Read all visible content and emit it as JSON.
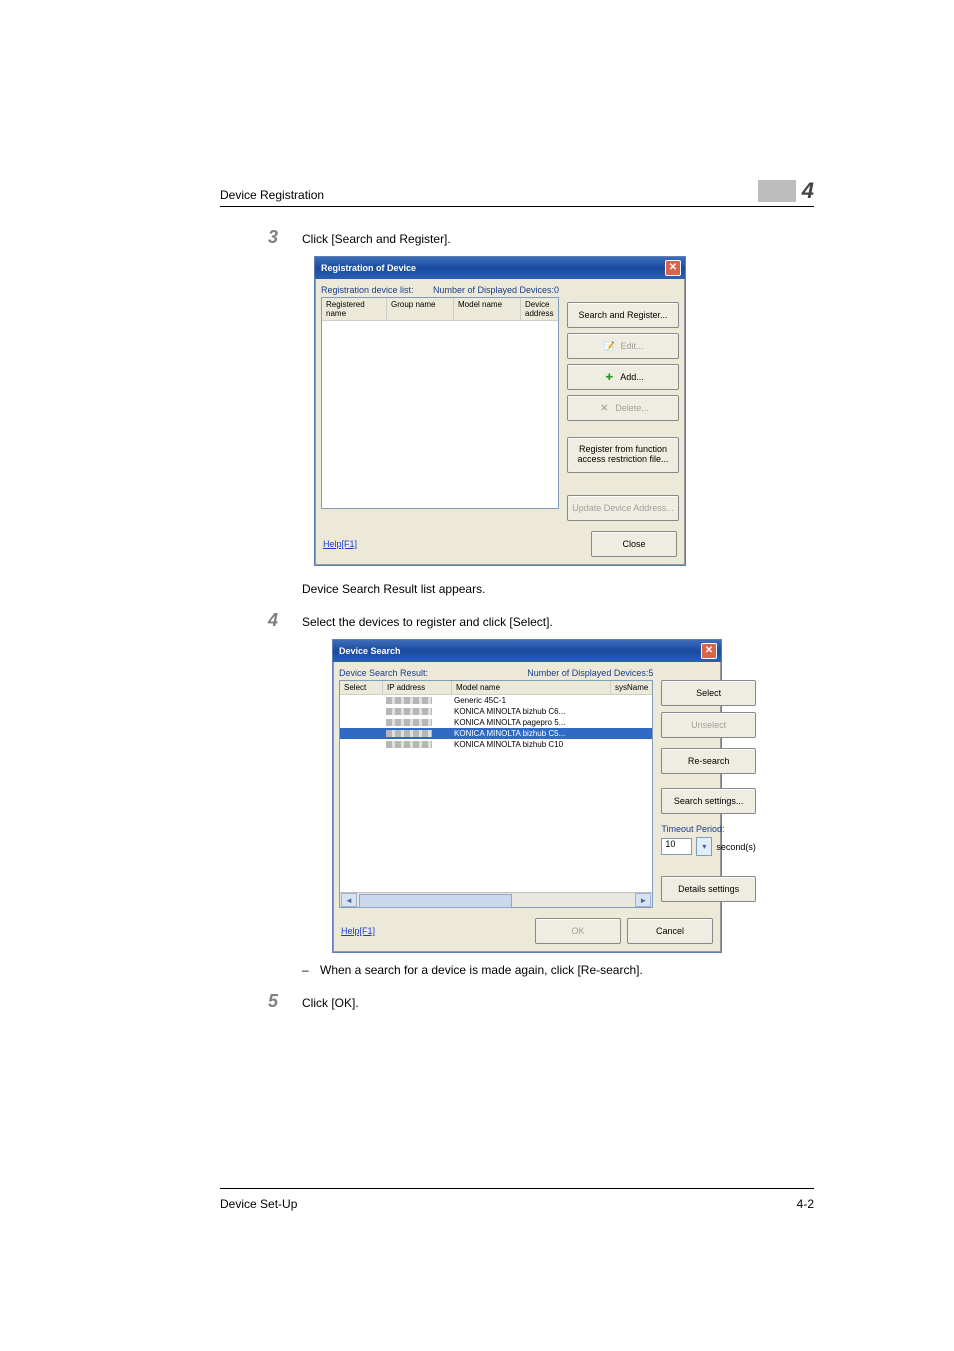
{
  "header": {
    "title": "Device Registration",
    "chapter": "4"
  },
  "steps": {
    "s3": {
      "num": "3",
      "text": "Click [Search and Register]."
    },
    "between_3_4": "Device Search Result list appears.",
    "s4": {
      "num": "4",
      "text": "Select the devices to register and click [Select]."
    },
    "bullet": "When a search for a device is made again, click [Re-search].",
    "s5": {
      "num": "5",
      "text": "Click [OK]."
    }
  },
  "dialog1": {
    "title": "Registration of Device",
    "list_label": "Registration device list:",
    "count_label": "Number of Displayed Devices:0",
    "columns": {
      "registered": "Registered name",
      "group": "Group name",
      "model": "Model name",
      "device": "Device address"
    },
    "buttons": {
      "search": "Search and Register...",
      "edit": "Edit...",
      "add": "Add...",
      "delete": "Delete...",
      "register_from": "Register from function access restriction file...",
      "update": "Update Device Address...",
      "close": "Close"
    },
    "help": "Help[F1]"
  },
  "dialog2": {
    "title": "Device Search",
    "result_label": "Device Search Result:",
    "count_label": "Number of Displayed Devices:5",
    "columns": {
      "sel": "Select",
      "ip": "IP address",
      "model": "Model name",
      "sys": "sysName"
    },
    "rows": [
      {
        "model": "Generic 45C-1"
      },
      {
        "model": "KONICA MINOLTA bizhub C6..."
      },
      {
        "model": "KONICA MINOLTA pagepro 5..."
      },
      {
        "model": "KONICA MINOLTA bizhub C5...",
        "selected": true
      },
      {
        "model": "KONICA MINOLTA bizhub C10"
      }
    ],
    "buttons": {
      "select": "Select",
      "unselect": "Unselect",
      "research": "Re-search",
      "search_settings": "Search settings...",
      "details": "Details settings",
      "ok": "OK",
      "cancel": "Cancel"
    },
    "timeout": {
      "label": "Timeout Period:",
      "value": "10",
      "unit": "second(s)"
    },
    "help": "Help[F1]"
  },
  "footer": {
    "section": "Device Set-Up",
    "page": "4-2"
  }
}
